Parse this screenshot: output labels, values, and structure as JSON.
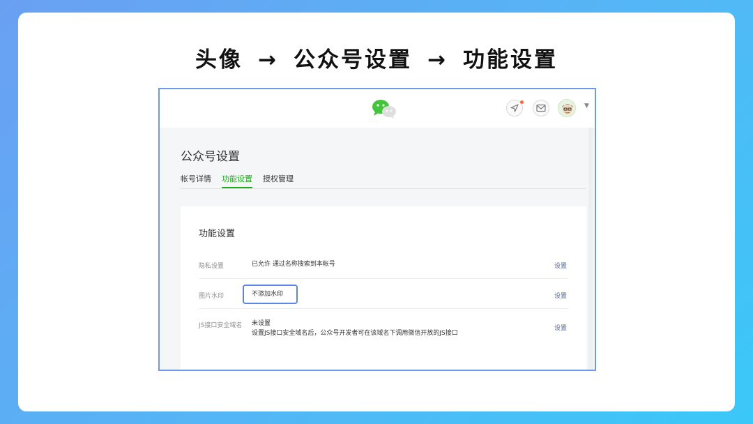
{
  "headline": {
    "step1": "头像",
    "arrow": "→",
    "step2": "公众号设置",
    "step3": "功能设置"
  },
  "header": {
    "icons": [
      "wechat-logo-icon",
      "location-arrow-icon",
      "mail-icon",
      "avatar",
      "chevron-down-icon"
    ],
    "notification_color": "#f26b3a"
  },
  "page": {
    "title": "公众号设置",
    "tabs": [
      {
        "label": "帐号详情",
        "active": false
      },
      {
        "label": "功能设置",
        "active": true
      },
      {
        "label": "授权管理",
        "active": false
      }
    ]
  },
  "panel": {
    "title": "功能设置",
    "rows": [
      {
        "label": "隐私设置",
        "value": "已允许 通过名称搜索到本帐号",
        "action": "设置"
      },
      {
        "label": "图片水印",
        "value": "不添加水印",
        "action": "设置"
      },
      {
        "label": "JS接口安全域名",
        "value": "未设置",
        "description": "设置JS接口安全域名后，公众号开发者可在该域名下调用微信开放的JS接口",
        "action": "设置"
      }
    ]
  },
  "colors": {
    "accent_green": "#1aad19",
    "link": "#576b95",
    "highlight": "#5b86e8"
  }
}
